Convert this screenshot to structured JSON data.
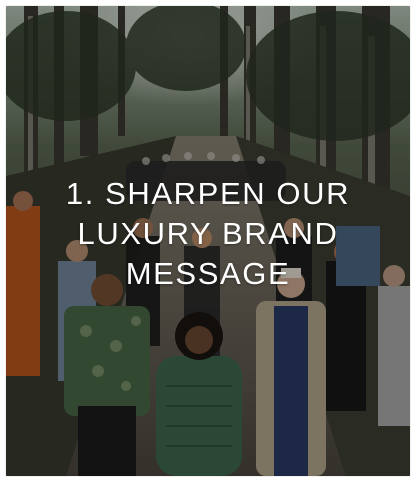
{
  "card": {
    "headline": "1. SHARPEN OUR LUXURY BRAND MESSAGE",
    "image": "runway-models-forest-path"
  },
  "colors": {
    "overlay": "#000000",
    "text": "#ffffff"
  }
}
